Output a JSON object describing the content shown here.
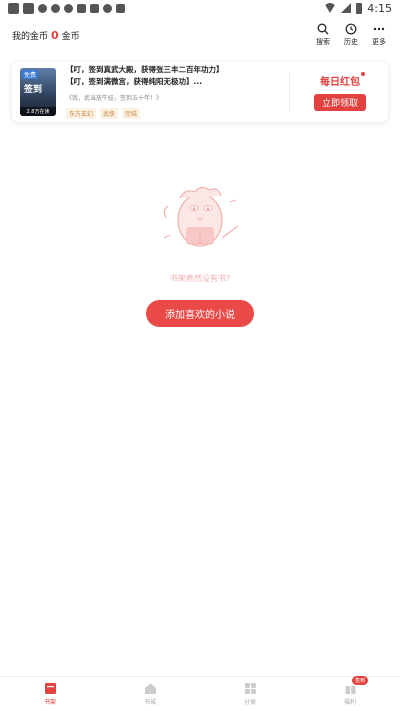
{
  "status_bar": {
    "time": "4:15",
    "icons": [
      "app-icon",
      "app-icon",
      "o-icon",
      "o-icon",
      "o-icon",
      "image-icon",
      "book-icon",
      "shield-icon",
      "a-icon"
    ]
  },
  "header": {
    "coins_label": "我的金币",
    "coins_value": "0",
    "coins_unit": "金币",
    "actions": [
      {
        "label": "搜索",
        "icon": "search-icon"
      },
      {
        "label": "历史",
        "icon": "clock-icon"
      },
      {
        "label": "更多",
        "icon": "more-icon"
      }
    ]
  },
  "recommend": {
    "cover_tag": "免费",
    "cover_title": "签到",
    "reading": "2.8万在读",
    "title_line1": "【叮，签到真武大殿，获得张三丰二百年功力】",
    "title_line2": "【叮，签到满微宫，获得纯阳无极功】...",
    "description": "《我，武当放牛娃，签到五十年！》",
    "tags": [
      "东方玄幻",
      "武侠",
      "完结"
    ],
    "red_packet_title": "每日红包",
    "red_packet_button": "立即领取"
  },
  "empty": {
    "message": "书架竟然没有书?",
    "button": "添加喜欢的小说"
  },
  "bottom_nav": {
    "items": [
      {
        "label": "书架",
        "icon": "bookshelf-icon",
        "active": true
      },
      {
        "label": "书城",
        "icon": "store-icon",
        "active": false
      },
      {
        "label": "分类",
        "icon": "category-icon",
        "active": false
      },
      {
        "label": "福利",
        "icon": "gift-icon",
        "active": false,
        "badge": "签到"
      }
    ]
  },
  "colors": {
    "accent": "#e2413f",
    "tag_text": "#c9873a",
    "empty_text": "#f0b0ae"
  }
}
